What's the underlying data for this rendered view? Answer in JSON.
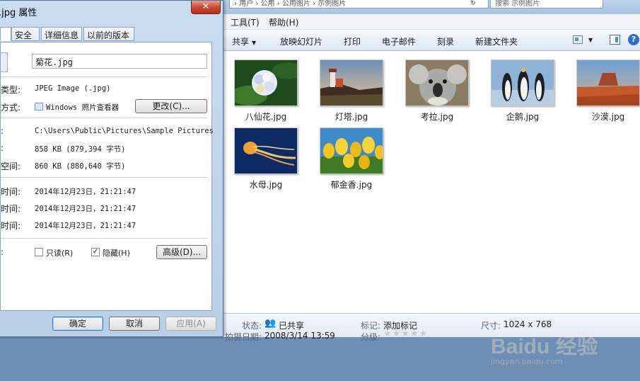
{
  "explorer": {
    "address": "› 用户 › 公用 › 公用图片 › 示例图片",
    "refresh_glyph": "↻",
    "search_placeholder": "搜索 示例图片",
    "menu": [
      {
        "label": "工具(T)"
      },
      {
        "label": "帮助(H)"
      }
    ],
    "toolbar": {
      "share": "共享",
      "slideshow": "放映幻灯片",
      "print": "打印",
      "email": "电子邮件",
      "burn": "刻录",
      "new_folder": "新建文件夹",
      "help": "?"
    },
    "files": [
      {
        "name": "八仙花.jpg",
        "icon": "hydrangea-thumbnail"
      },
      {
        "name": "灯塔.jpg",
        "icon": "lighthouse-thumbnail"
      },
      {
        "name": "考拉.jpg",
        "icon": "koala-thumbnail"
      },
      {
        "name": "企鹅.jpg",
        "icon": "penguins-thumbnail"
      },
      {
        "name": "沙漠.jpg",
        "icon": "desert-thumbnail"
      },
      {
        "name": "水母.jpg",
        "icon": "jellyfish-thumbnail"
      },
      {
        "name": "郁金香.jpg",
        "icon": "tulips-thumbnail"
      }
    ],
    "details": {
      "status_label": "状态:",
      "status_value": "已共享",
      "tag_label": "标记:",
      "tag_value": "添加标记",
      "size_label": "尺寸:",
      "size_value": "1024 x 768",
      "date_label": "拍摄日期:",
      "date_value": "2008/3/14 13:59",
      "rating_label": "分级:",
      "rating_stars": 0,
      "rating_max": 5
    },
    "watermark": {
      "text": "Baidu 经验",
      "url": "jingyan.baidu.com"
    }
  },
  "dialog": {
    "title": ".jpg 属性",
    "close_glyph": "✕",
    "tabs": [
      {
        "label": ""
      },
      {
        "label": "安全"
      },
      {
        "label": "详细信息"
      },
      {
        "label": "以前的版本"
      }
    ],
    "filename": "菊花.jpg",
    "rows": {
      "type_label": "类型:",
      "type_value": "JPEG Image (.jpg)",
      "open_label": "方式:",
      "open_value": "Windows 照片查看器",
      "change_button": "更改(C)...",
      "location_label": ":",
      "location_value": "C:\\Users\\Public\\Pictures\\Sample Pictures",
      "size_label": ":",
      "size_value": "858 KB (879,394 字节)",
      "disk_label": "空间:",
      "disk_value": "860 KB (880,640 字节)",
      "created_label": "时间:",
      "created_value": "2014年12月23日，21:21:47",
      "modified_label": "时间:",
      "modified_value": "2014年12月23日，21:21:47",
      "accessed_label": "时间:",
      "accessed_value": "2014年12月23日，21:21:47",
      "attr_label": ":",
      "readonly_label": "只读(R)",
      "hidden_label": "隐藏(H)",
      "advanced_button": "高级(D)..."
    },
    "readonly_checked": false,
    "hidden_checked": true,
    "buttons": {
      "ok": "确定",
      "cancel": "取消",
      "apply": "应用(A)"
    }
  }
}
